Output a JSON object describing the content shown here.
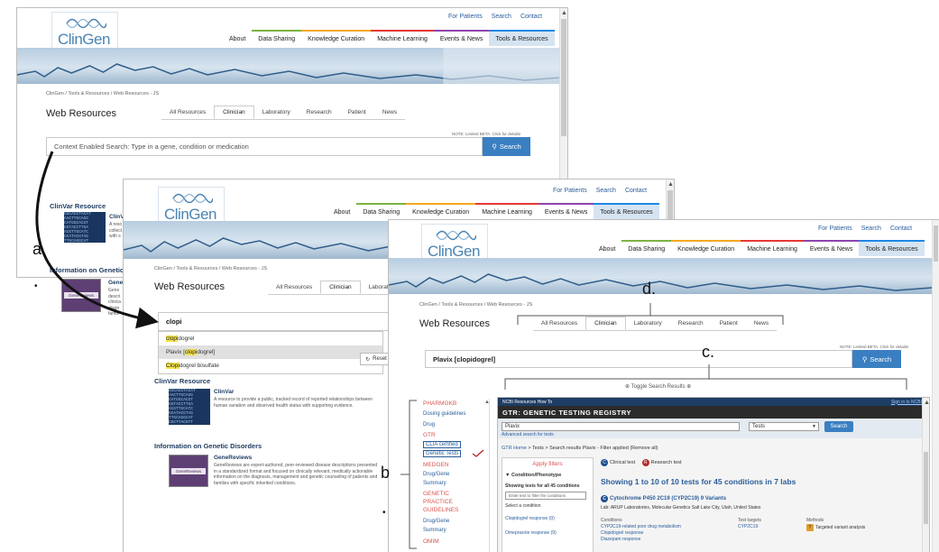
{
  "site": {
    "logo_text": "ClinGen",
    "logo_subtitle": "Clinical Genome Resource",
    "top_links": [
      "For Patients",
      "Search",
      "Contact"
    ],
    "nav": [
      "About",
      "Data Sharing",
      "Knowledge Curation",
      "Machine Learning",
      "Events & News",
      "Tools & Resources"
    ],
    "breadcrumb": "ClinGen / Tools & Resources / Web Resources - JS",
    "page_title": "Web Resources",
    "tabs": [
      "All Resources",
      "Clinician",
      "Laboratory",
      "Research",
      "Patient",
      "News"
    ],
    "note": "NOTE: Limited BETA. Click for details!",
    "search_button": "Search"
  },
  "screen1": {
    "search_placeholder": "Context Enabled Search: Type in a gene, condition or medication",
    "clinvar_title": "ClinVar Resource",
    "clinvar_item": "ClinV",
    "clinvar_desc": "A reso\ncollect\nwith s",
    "genetic_title": "Information on Genetic",
    "genetic_item": "Gene",
    "genetic_desc": "Gene\ndescri\nclinica\ndiagn\nfamili"
  },
  "screen2": {
    "search_value": "clopi",
    "dropdown": [
      {
        "pre": "",
        "match": "clopi",
        "post": "dogrel"
      },
      {
        "pre": "Plavix [",
        "match": "clopi",
        "post": "dogrel]"
      },
      {
        "pre": "",
        "match": "Clopi",
        "post": "dogrel bisulfate"
      }
    ],
    "reset_label": "Reset",
    "clinvar_title": "ClinVar Resource",
    "clinvar_item": "ClinVar",
    "clinvar_desc": "A resource to provide a public, tracked record of reported relationships between human variation and observed health status with supporting evidence.",
    "genetic_title": "Information on Genetic Disorders",
    "genetic_item": "GeneReviews",
    "genetic_desc": "GeneReviews are expert-authored, peer-reviewed disease descriptions presented in a standardized format and focused on clinically relevant, medically actionable information on the diagnosis, management and genetic counseling of patients and families with specific inherited conditions.",
    "book_label": "GeneReviews"
  },
  "screen3": {
    "search_value": "Plavix [clopidogrel]",
    "toggle_label": "Toggle Search Results",
    "side": [
      {
        "text": "PHARMGKB",
        "kind": "head"
      },
      {
        "text": "Dosing guidelines",
        "kind": "link"
      },
      {
        "text": "Drug",
        "kind": "link"
      },
      {
        "text": "GTR",
        "kind": "head"
      },
      {
        "text": "CLIA certified",
        "kind": "box"
      },
      {
        "text": "Genetic Tests",
        "kind": "box"
      },
      {
        "text": "MEDGEN",
        "kind": "head"
      },
      {
        "text": "Drug/Gene",
        "kind": "link"
      },
      {
        "text": "Summary",
        "kind": "link"
      },
      {
        "text": "GENETIC",
        "kind": "head"
      },
      {
        "text": "PRACTICE",
        "kind": "head"
      },
      {
        "text": "GUIDELINES",
        "kind": "head"
      },
      {
        "text": "Drug/Gene",
        "kind": "link"
      },
      {
        "text": "Summary",
        "kind": "link"
      },
      {
        "text": "OMIM",
        "kind": "head"
      }
    ],
    "gtr": {
      "top_bar": "NCBI   Resources   How To",
      "sign_in": "Sign in to NCBI",
      "title": "GTR: GENETIC TESTING REGISTRY",
      "query": "Plavix",
      "scope": "Tests",
      "search_btn": "Search",
      "advanced": "Advanced search for tests",
      "breadcrumb_link": "GTR Home",
      "breadcrumb_rest": " > Tests > Search results  Plavix - Filter applied (Remove all)",
      "clinical_label": "Clinical test",
      "research_label": "Research test",
      "filters_title": "Apply filters",
      "filter_section": "Condition/Phenotype",
      "filter_info": "Showing tests for all 45 conditions",
      "filter_input": "Enter text to filter the conditions",
      "select_condition": "Select a condition",
      "cond1": "Clopidogrel response (9)",
      "cond2": "Omeprazole response (9)",
      "showing": "Showing 1 to 10 of 10 tests for 45 conditions in 7 labs",
      "result_title": "Cytochrome P450 2C19 (CYP2C19) 9 Variants",
      "lab": "Lab: ARUP Laboratories, Molecular Genetics Salt Lake City, Utah, United States",
      "col_conditions": "Conditions",
      "col_targets": "Test targets",
      "col_methods": "Methods",
      "cond_link1": "CYP2C19-related poor drug metabolism",
      "cond_link2": "Clopidogrel response",
      "cond_link3": "Diazepam response",
      "target": "CYP2C19",
      "method": "Targeted variant analysis"
    }
  },
  "annotations": {
    "a": "a",
    "b": "b",
    "c": "c.",
    "d": "d."
  }
}
